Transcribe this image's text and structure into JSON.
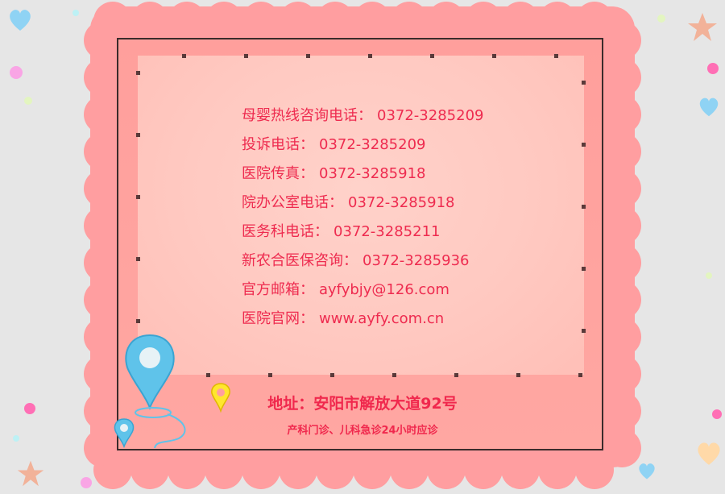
{
  "contacts": [
    {
      "label": "母婴热线咨询电话：",
      "value": "0372-3285209"
    },
    {
      "label": "投诉电话：",
      "value": "0372-3285209"
    },
    {
      "label": "医院传真：",
      "value": "0372-3285918"
    },
    {
      "label": "院办公室电话：",
      "value": "0372-3285918"
    },
    {
      "label": "医务科电话：",
      "value": "0372-3285211"
    },
    {
      "label": "新农合医保咨询：",
      "value": "0372-3285936"
    },
    {
      "label": "官方邮箱：",
      "value": "ayfybjy@126.com"
    },
    {
      "label": "医院官网：",
      "value": "www.ayfy.com.cn"
    }
  ],
  "address": "地址：安阳市解放大道92号",
  "hours": "产科门诊、儿科急诊24小时应诊",
  "icons": [
    "location-pin-icon",
    "small-location-pin-icon",
    "yellow-location-pin-icon",
    "heart-icon",
    "star-icon",
    "dot-icon"
  ],
  "colors": {
    "text": "#ee2b4f",
    "scallop": "#ff9ea0",
    "panel": "#ffcbc3",
    "background": "#e6e6e6"
  }
}
